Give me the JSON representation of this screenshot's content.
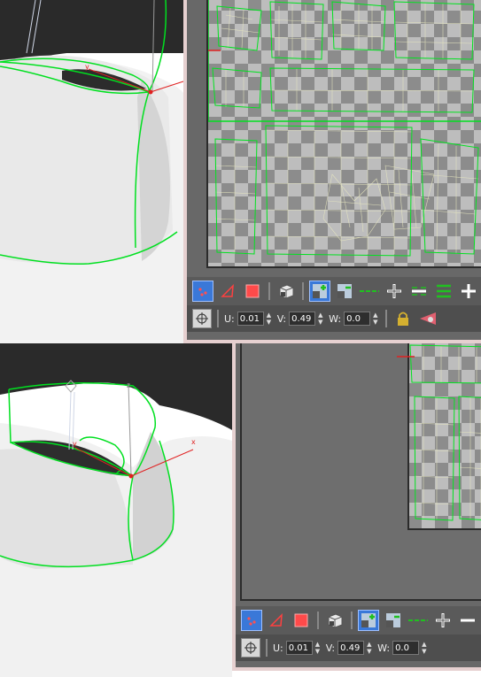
{
  "views": [
    {
      "id": "top",
      "viewport": {
        "axis_x": "x",
        "axis_y": "y",
        "axis_z": "z",
        "colors": {
          "background": "#ffffff",
          "void": "#2a2a2a",
          "seam": "#00e020",
          "uv_grid": "#e0e0b8",
          "gizmo_axis": "#e02020"
        }
      },
      "uv_editor": {
        "coordinates": {
          "u_label": "U:",
          "u_value": "0.01",
          "v_label": "V:",
          "v_value": "0.49",
          "w_label": "W:",
          "w_value": "0.0"
        },
        "toolbar_icons": [
          "vertex-select-icon",
          "edge-select-icon",
          "face-select-icon",
          "element-select-icon",
          "grow-select-icon",
          "shrink-select-icon",
          "loop-select-icon",
          "ring-plus-icon",
          "ring-minus-icon",
          "grow-loop-icon"
        ],
        "lock_icon": "lock-icon",
        "filter_icon": "paint-filter-icon"
      }
    },
    {
      "id": "bottom",
      "viewport": {
        "axis_x": "x",
        "axis_y": "y",
        "axis_z": "z"
      },
      "uv_editor": {
        "coordinates": {
          "u_label": "U:",
          "u_value": "0.01",
          "v_label": "V:",
          "v_value": "0.49",
          "w_label": "W:",
          "w_value": "0.0"
        }
      }
    }
  ]
}
